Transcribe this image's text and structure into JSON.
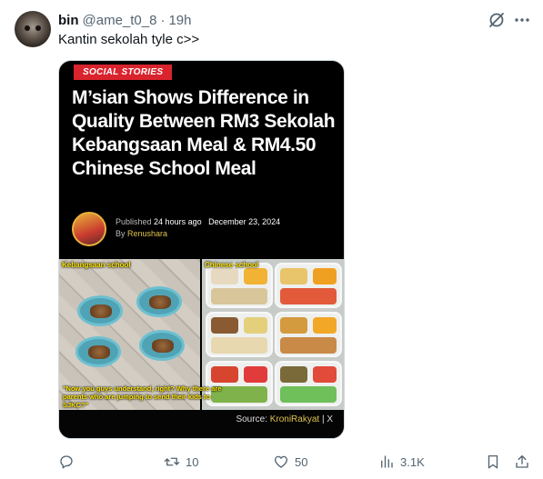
{
  "tweet": {
    "author_name": "bin",
    "handle": "@ame_t0_8",
    "separator": "·",
    "time": "19h",
    "text": "Kantin sekolah tyle c>>"
  },
  "card": {
    "tag": "SOCIAL STORIES",
    "headline": "M’sian Shows Difference in Quality Between RM3 Sekolah Kebangsaan Meal & RM4.50 Chinese School Meal",
    "published_prefix": "Published",
    "published_ago": "24 hours ago",
    "published_date": "December 23, 2024",
    "by_prefix": "By",
    "author": "Renushara",
    "left_label": "Kebangsaan school",
    "right_label": "Chinese school",
    "caption": "\"Now you guys understand, right? Why there are parents who are jumping to send their kids to SJKC?\"",
    "source_prefix": "Source:",
    "source_name": "KroniRakyat",
    "source_suffix": "| X"
  },
  "actions": {
    "reply_count": "",
    "retweet_count": "10",
    "like_count": "50",
    "views_count": "3.1K"
  },
  "colors": {
    "accent_tag": "#d9232d",
    "muted_text": "#536471",
    "caption_yellow": "#ffe600"
  },
  "icons": [
    "grok-icon",
    "more-icon",
    "reply-icon",
    "retweet-icon",
    "like-icon",
    "views-icon",
    "bookmark-icon",
    "share-icon"
  ]
}
